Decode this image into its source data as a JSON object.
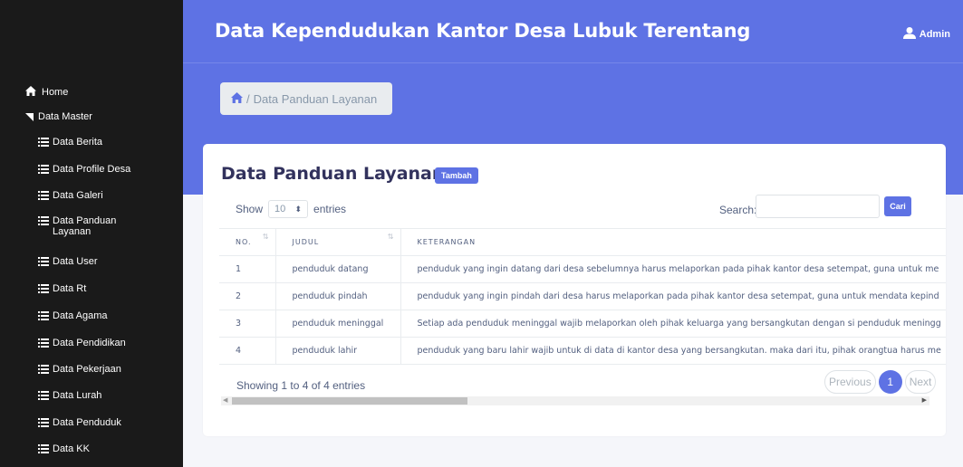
{
  "app": {
    "title": "Data Kependudukan Kantor Desa Lubuk Terentang",
    "user": "Admin"
  },
  "sidebar": {
    "home": "Home",
    "master": "Data Master",
    "items": [
      {
        "label": "Data Berita"
      },
      {
        "label": "Data Profile Desa"
      },
      {
        "label": "Data Galeri"
      },
      {
        "label": "Data Panduan Layanan"
      },
      {
        "label": "Data User"
      },
      {
        "label": "Data Rt"
      },
      {
        "label": "Data Agama"
      },
      {
        "label": "Data Pendidikan"
      },
      {
        "label": "Data Pekerjaan"
      },
      {
        "label": "Data Lurah"
      },
      {
        "label": "Data Penduduk"
      },
      {
        "label": "Data KK"
      }
    ]
  },
  "breadcrumb": {
    "separator": "/",
    "current": "Data Panduan Layanan"
  },
  "card": {
    "title": "Data Panduan Layanan",
    "add_button": "Tambah"
  },
  "controls": {
    "show_label": "Show",
    "entries_value": "10",
    "entries_label": "entries",
    "search_label": "Search:",
    "search_value": "",
    "search_button": "Cari"
  },
  "table": {
    "headers": [
      "NO.",
      "JUDUL",
      "KETERANGAN"
    ],
    "rows": [
      {
        "no": "1",
        "judul": "penduduk datang",
        "keterangan": "penduduk yang ingin datang dari desa sebelumnya harus melaporkan pada pihak kantor desa setempat, guna untuk me"
      },
      {
        "no": "2",
        "judul": "penduduk pindah",
        "keterangan": "penduduk yang ingin pindah dari desa harus melaporkan pada pihak kantor desa setempat, guna untuk mendata kepind"
      },
      {
        "no": "3",
        "judul": "penduduk meninggal",
        "keterangan": "Setiap ada penduduk meninggal wajib melaporkan oleh pihak keluarga yang bersangkutan dengan si penduduk meningg"
      },
      {
        "no": "4",
        "judul": "penduduk lahir",
        "keterangan": "penduduk yang baru lahir wajib untuk di data di kantor desa yang bersangkutan. maka dari itu, pihak orangtua harus me"
      }
    ]
  },
  "footer": {
    "info": "Showing 1 to 4 of 4 entries",
    "previous": "Previous",
    "current_page": "1",
    "next": "Next"
  }
}
